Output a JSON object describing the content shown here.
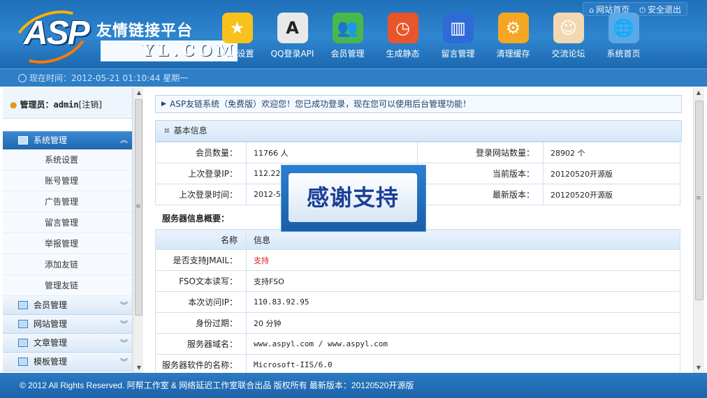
{
  "header": {
    "logo_text": "ASP",
    "logo_sub": "YL.COM",
    "site_title": "友情链接平台",
    "top_links": {
      "home": "网站首页",
      "logout": "安全退出"
    },
    "nav": [
      {
        "label": "系统设置",
        "icon": "star-icon",
        "color": "#f6c21b",
        "glyph": "★"
      },
      {
        "label": "QQ登录API",
        "icon": "font-a-icon",
        "color": "#e9e9e9",
        "glyph": "A"
      },
      {
        "label": "会员管理",
        "icon": "users-icon",
        "color": "#49b84a",
        "glyph": "👥"
      },
      {
        "label": "生成静态",
        "icon": "clock-screen-icon",
        "color": "#e8552b",
        "glyph": "◷"
      },
      {
        "label": "留言管理",
        "icon": "binders-icon",
        "color": "#2f6bd6",
        "glyph": "▥"
      },
      {
        "label": "清理缓存",
        "icon": "gear-icon",
        "color": "#f5a623",
        "glyph": "⚙"
      },
      {
        "label": "交流论坛",
        "icon": "chat-people-icon",
        "color": "#f1d8b0",
        "glyph": "☺"
      },
      {
        "label": "系统首页",
        "icon": "globe-icon",
        "color": "#5aa8e8",
        "glyph": "🌐"
      }
    ]
  },
  "timebar": {
    "text": "现在时间：2012-05-21 01:10:44 星期一"
  },
  "sidebar": {
    "admin_label": "管理员：",
    "admin_name": "admin",
    "logout": "[注销]",
    "active_group": "系统管理",
    "sub_items": [
      "系统设置",
      "账号管理",
      "广告管理",
      "留言管理",
      "举报管理",
      "添加友链",
      "管理友链"
    ],
    "groups": [
      "会员管理",
      "网站管理",
      "文章管理",
      "模板管理"
    ]
  },
  "main": {
    "welcome": "ASP友链系统（免费版）欢迎您！您已成功登录，现在您可以使用后台管理功能！",
    "basic_title": "基本信息",
    "basic": [
      {
        "k1": "会员数量：",
        "v1": "11766 人",
        "k2": "登录网站数量：",
        "v2": "28902 个"
      },
      {
        "k1": "上次登录IP：",
        "v1": "112.22",
        "k2": "当前版本：",
        "v2": "20120520开源版"
      },
      {
        "k1": "上次登录时间：",
        "v1": "2012-5",
        "k2": "最新版本：",
        "v2": "20120520开源版"
      }
    ],
    "server_title": "服务器信息概要：",
    "server_head": {
      "name": "名称",
      "info": "信息"
    },
    "server": [
      {
        "k": "是否支持JMAIL：",
        "v": "支持"
      },
      {
        "k": "FSO文本读写：",
        "v": "支持FSO"
      },
      {
        "k": "本次访问IP：",
        "v": "110.83.92.95"
      },
      {
        "k": "身份过期：",
        "v": "20 分钟"
      },
      {
        "k": "服务器域名：",
        "v": "www.aspyl.com / www.aspyl.com"
      },
      {
        "k": "服务器软件的名称：",
        "v": "Microsoft-IIS/6.0"
      }
    ]
  },
  "popup": {
    "text": "感谢支持"
  },
  "footer": {
    "text": "© 2012 All Rights Reserved. 阿帮工作室 & 网络延迟工作室联合出品 版权所有 最新版本：20120520开源版"
  }
}
